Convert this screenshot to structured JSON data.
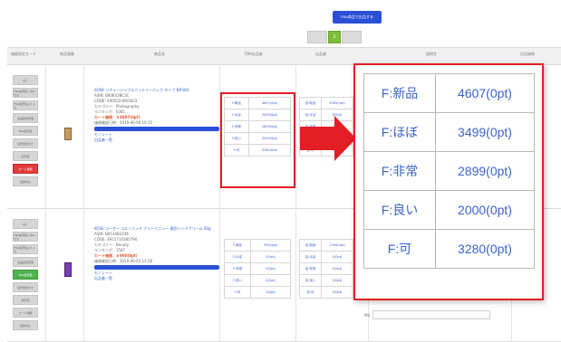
{
  "toolbar": {
    "fba_button_label": "FBA商品で出品する",
    "page_number": "1"
  },
  "header": {
    "columns": [
      "価格改定モード",
      "商品画像",
      "商品名",
      "FBA出品者",
      "出品者",
      "説明文",
      "出品価格"
    ]
  },
  "sidebar_buttons": [
    "なし",
    "FBA最安値に合わせる",
    "FBA最安値より-1円",
    "出品者最安値",
    "FBA最安値",
    "最安値合わせ",
    "最安値",
    "カート価格",
    "自動停止"
  ],
  "products": [
    {
      "title": "SONY リチャージャブルバッテリーパック タイプ NP-BX1",
      "asin": "ASIN: B00K43BC3C",
      "code": "CODE: 4905524965603",
      "category": "カテゴリー：Photography",
      "rank": "ランキング：6381",
      "cart_price": "カート価格：￥4607(0pt)",
      "updated": "価格確認日時：2019-06-06 10:15",
      "action_label": "価格を編集",
      "memo": "モノレート",
      "list": "出品者一覧",
      "fba": [
        {
          "label": "F:新品",
          "price": "4607(0pt)"
        },
        {
          "label": "F:ほぼ",
          "price": "3499(0pt)"
        },
        {
          "label": "F:非常",
          "price": "2899(0pt)"
        },
        {
          "label": "F:良い",
          "price": "2000(0pt)"
        },
        {
          "label": "F:可",
          "price": "3280(0pt)"
        }
      ],
      "seller": [
        {
          "label": "自:新品",
          "price": "4565(0pt)"
        },
        {
          "label": "自:ほぼ",
          "price": "0(0pt)"
        },
        {
          "label": "自:非常",
          "price": "0(0pt)"
        },
        {
          "label": "自:良い",
          "price": "0(0pt)"
        },
        {
          "label": "自:可",
          "price": "0(0pt)"
        }
      ]
    },
    {
      "title": "KOSE コーセー コエンリッチ ナイトリニュー 薬用ハンドクリーム 60g",
      "asin": "ASIN: B013482Z46",
      "code": "CODE: 4971710385790",
      "category": "カテゴリー：Beauty",
      "rank": "ランキング：1587",
      "cart_price": "カート価格：￥900(0pt)",
      "updated": "価格確認日時：2019-06-03 13:58",
      "action_label": "価格を編集",
      "memo": "モノレート",
      "list": "出品者一覧",
      "fba": [
        {
          "label": "F:新品",
          "price": "900(0pt)"
        },
        {
          "label": "F:ほぼ",
          "price": "0(0pt)"
        },
        {
          "label": "F:非常",
          "price": "0(0pt)"
        },
        {
          "label": "F:良い",
          "price": "0(0pt)"
        },
        {
          "label": "F:可",
          "price": "0(0pt)"
        }
      ],
      "seller": [
        {
          "label": "自:新品",
          "price": "1300(0pt)"
        },
        {
          "label": "自:ほぼ",
          "price": "0(0pt)"
        },
        {
          "label": "自:非常",
          "price": "0(0pt)"
        },
        {
          "label": "自:良い",
          "price": "0(0pt)"
        },
        {
          "label": "自:可",
          "price": "0(0pt)"
        }
      ]
    }
  ],
  "zoom": [
    {
      "label": "F:新品",
      "price": "4607(0pt)"
    },
    {
      "label": "F:ほぼ",
      "price": "3499(0pt)"
    },
    {
      "label": "F:非常",
      "price": "2899(0pt)"
    },
    {
      "label": "F:良い",
      "price": "2000(0pt)"
    },
    {
      "label": "F:可",
      "price": "3280(0pt)"
    }
  ],
  "right_fragments": {
    "mu_label": "MU"
  },
  "colors": {
    "accent_blue": "#2b50d6",
    "highlight_red": "#e31e24",
    "active_green": "#7cbd3a"
  }
}
